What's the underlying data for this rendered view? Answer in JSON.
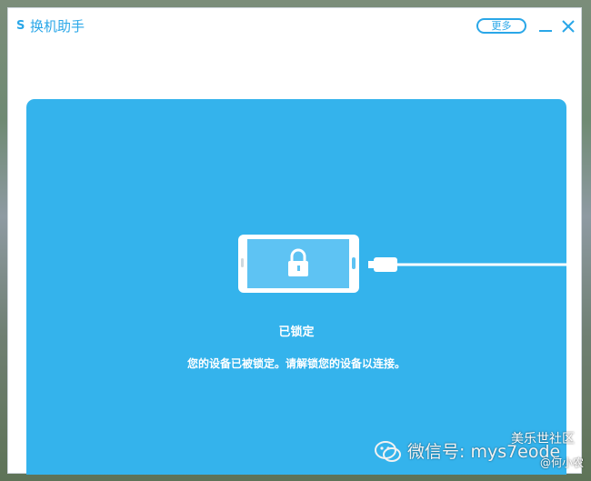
{
  "app": {
    "logo_text": "S",
    "title": "换机助手"
  },
  "titlebar": {
    "more_label": "更多",
    "minimize_icon": "minimize-icon",
    "close_icon": "close-icon"
  },
  "main": {
    "device_icon": "phone-locked-icon",
    "cable_icon": "usb-cable-icon",
    "status_title": "已锁定",
    "status_message": "您的设备已被锁定。请解锁您的设备以连接。"
  },
  "watermark": {
    "icon": "wechat-icon",
    "wechat_text": "微信号: mys7eode",
    "community_text": "美乐世社区",
    "author_text": "@何小农"
  },
  "colors": {
    "accent": "#2aa7e8",
    "panel_bg": "#34b3ec",
    "screen_bg": "#5ec3f3"
  }
}
